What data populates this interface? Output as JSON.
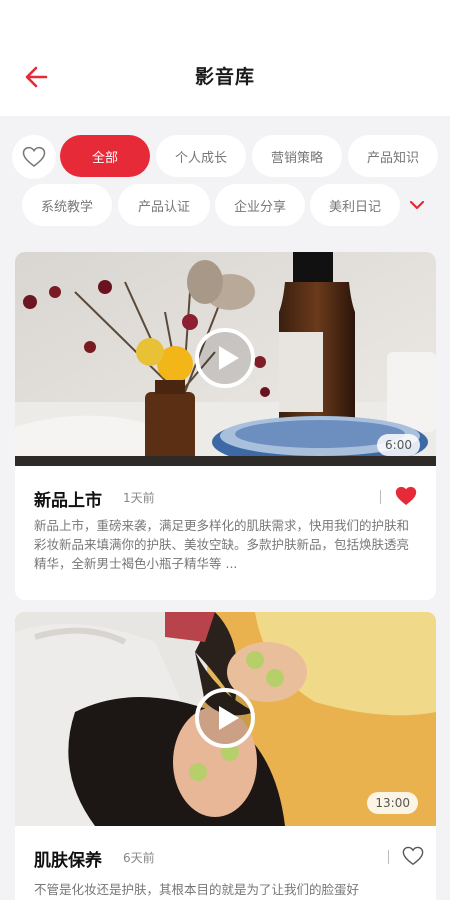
{
  "header": {
    "title": "影音库"
  },
  "filters": {
    "chips_row1": [
      "全部",
      "个人成长",
      "营销策略",
      "产品知识"
    ],
    "chips_row2": [
      "系统教学",
      "产品认证",
      "企业分享",
      "美利日记"
    ],
    "active": "全部"
  },
  "videos": [
    {
      "title": "新品上市",
      "time": "1天前",
      "duration": "6:00",
      "liked": true,
      "description": "新品上市，重磅来袭，满足更多样化的肌肤需求，快用我们的护肤和彩妆新品来填满你的护肤、美妆空缺。多款护肤新品，包括焕肤透亮精华，全新男士褐色小瓶子精华等 ..."
    },
    {
      "title": "肌肤保养",
      "time": "6天前",
      "duration": "13:00",
      "liked": false,
      "description": "不管是化妆还是护肤，其根本目的就是为了让我们的脸蛋好"
    }
  ],
  "colors": {
    "accent": "#e62a38",
    "background": "#f3f3f5"
  }
}
